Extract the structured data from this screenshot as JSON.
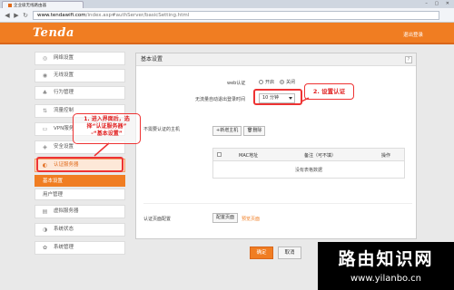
{
  "browser": {
    "tab_title": "企业级无线路由器",
    "window_controls": "– ▢ ✕",
    "back": "◀",
    "forward": "▶",
    "reload": "↻",
    "url_host": "www.tendawifi.com",
    "url_path": "/index.asp#authServer/basicSetting.html"
  },
  "header": {
    "logo": "Tenda",
    "logout": "退出登录",
    "color": "#f07d22"
  },
  "sidebar": {
    "items": [
      {
        "label": "网络设置",
        "icon": "globe-icon",
        "glyph": "◎"
      },
      {
        "label": "无线设置",
        "icon": "wifi-icon",
        "glyph": "◉"
      },
      {
        "label": "行为管理",
        "icon": "behavior-icon",
        "glyph": "♣"
      },
      {
        "label": "流量控制",
        "icon": "traffic-icon",
        "glyph": "⇅"
      },
      {
        "label": "VPN服务",
        "icon": "vpn-icon",
        "glyph": "▭"
      },
      {
        "label": "安全设置",
        "icon": "shield-icon",
        "glyph": "◈"
      },
      {
        "label": "认证服务器",
        "icon": "auth-server-icon",
        "glyph": "◐"
      },
      {
        "label": "虚拟服务器",
        "icon": "virtual-server-icon",
        "glyph": "▤"
      },
      {
        "label": "系统状态",
        "icon": "status-icon",
        "glyph": "◑"
      },
      {
        "label": "系统管理",
        "icon": "gear-icon",
        "glyph": "✿"
      }
    ],
    "subitems": [
      {
        "label": "基本设置",
        "selected": true
      },
      {
        "label": "用户管理",
        "selected": false
      }
    ]
  },
  "panel": {
    "title": "基本设置",
    "help": "?",
    "web_auth_label": "web认证",
    "web_auth_on": "开启",
    "web_auth_off": "关闭",
    "web_auth_value": "关闭",
    "timeout_label": "无流量自动退出登录时间",
    "timeout_value": "10 分钟",
    "no_auth_hosts_label": "不需要认证的主机",
    "add_host_button": "+新增主机",
    "delete_button": "删除",
    "table_headers": [
      "MAC地址",
      "备注（可不填）",
      "操作"
    ],
    "empty_text": "没有表格数据",
    "auth_page_label": "认证页面配置",
    "config_page_button": "配置页面",
    "preview_link": "预览页面"
  },
  "footer": {
    "ok": "确定",
    "cancel": "取消"
  },
  "annotations": {
    "step1": [
      "1. 进入界面后，选",
      "择“认证服务器”",
      "-“基本设置”"
    ],
    "step2": "2. 设置认证",
    "color": "#e02020"
  },
  "watermark": {
    "title": "路由知识网",
    "url": "www.yilanbo.cn"
  }
}
